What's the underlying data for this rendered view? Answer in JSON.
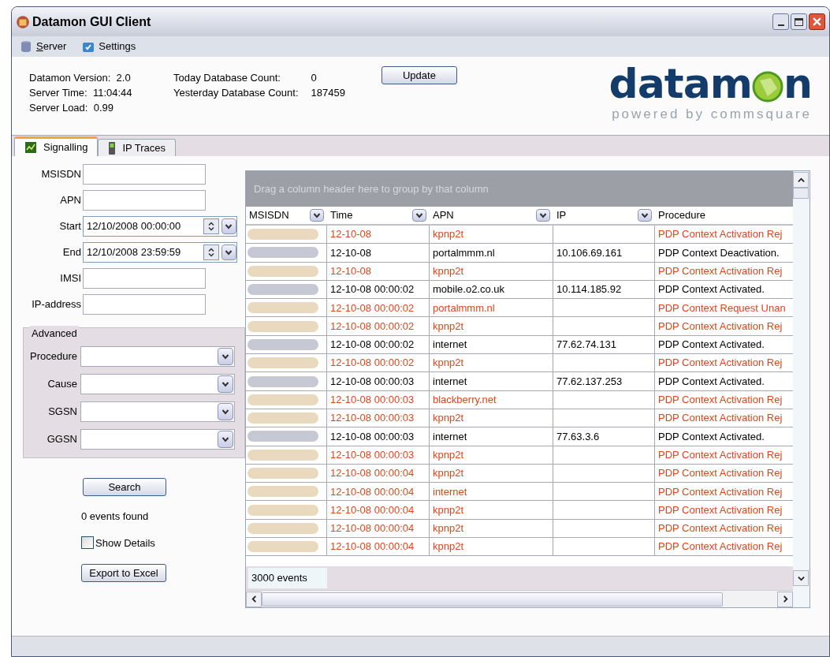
{
  "window": {
    "title": "Datamon GUI Client"
  },
  "menu": [
    {
      "label": "Server"
    },
    {
      "label": "Settings"
    }
  ],
  "info": [
    {
      "label": "Datamon Version:",
      "value": "2.0"
    },
    {
      "label": "Server Time:",
      "value": "11:04:44"
    },
    {
      "label": "Server Load:",
      "value": "0.99"
    }
  ],
  "counts": [
    {
      "label": "Today Database Count:",
      "value": "0"
    },
    {
      "label": "Yesterday Database Count:",
      "value": "187459"
    }
  ],
  "update_button": "Update",
  "logo": {
    "before": "datam",
    "after": "n",
    "tagline": "powered by commsquare"
  },
  "tabs": [
    {
      "label": "Signalling",
      "selected": true
    },
    {
      "label": "IP Traces",
      "selected": false
    }
  ],
  "fields": [
    {
      "label": "MSISDN",
      "kind": "text"
    },
    {
      "label": "APN",
      "kind": "text"
    },
    {
      "label": "Start",
      "kind": "datetime",
      "value": "12/10/2008 00:00:00"
    },
    {
      "label": "End",
      "kind": "datetime",
      "value": "12/10/2008 23:59:59"
    },
    {
      "label": "IMSI",
      "kind": "text"
    },
    {
      "label": "IP-address",
      "kind": "text"
    }
  ],
  "advanced": {
    "title": "Advanced",
    "fields": [
      "Procedure",
      "Cause",
      "SGSN",
      "GGSN"
    ]
  },
  "search_button": "Search",
  "events_found": "0 events found",
  "show_details": {
    "label": "Show Details",
    "checked": false
  },
  "export_button": "Export to Excel",
  "table": {
    "group_hint": "Drag a column header here to group by that column",
    "columns": [
      "MSISDN",
      "Time",
      "APN",
      "IP",
      "Procedure"
    ],
    "rows": [
      {
        "kind": "error",
        "time": "12-10-08",
        "apn": "kpnp2t",
        "ip": "",
        "procedure": "PDP Context Activation Rej"
      },
      {
        "kind": "normal",
        "time": "12-10-08",
        "apn": "portalmmm.nl",
        "ip": "10.106.69.161",
        "procedure": "PDP Context Deactivation."
      },
      {
        "kind": "error",
        "time": "12-10-08",
        "apn": "kpnp2t",
        "ip": "",
        "procedure": "PDP Context Activation Rej"
      },
      {
        "kind": "normal",
        "time": "12-10-08 00:00:02",
        "apn": "mobile.o2.co.uk",
        "ip": "10.114.185.92",
        "procedure": "PDP Context Activated."
      },
      {
        "kind": "error",
        "time": "12-10-08 00:00:02",
        "apn": "portalmmm.nl",
        "ip": "",
        "procedure": "PDP Context Request Unan"
      },
      {
        "kind": "error",
        "time": "12-10-08 00:00:02",
        "apn": "kpnp2t",
        "ip": "",
        "procedure": "PDP Context Activation Rej"
      },
      {
        "kind": "normal",
        "time": "12-10-08 00:00:02",
        "apn": "internet",
        "ip": "77.62.74.131",
        "procedure": "PDP Context Activated."
      },
      {
        "kind": "error",
        "time": "12-10-08 00:00:02",
        "apn": "kpnp2t",
        "ip": "",
        "procedure": "PDP Context Activation Rej"
      },
      {
        "kind": "normal",
        "time": "12-10-08 00:00:03",
        "apn": "internet",
        "ip": "77.62.137.253",
        "procedure": "PDP Context Activated."
      },
      {
        "kind": "error",
        "time": "12-10-08 00:00:03",
        "apn": "blackberry.net",
        "ip": "",
        "procedure": "PDP Context Activation Rej"
      },
      {
        "kind": "error",
        "time": "12-10-08 00:00:03",
        "apn": "kpnp2t",
        "ip": "",
        "procedure": "PDP Context Activation Rej"
      },
      {
        "kind": "normal",
        "time": "12-10-08 00:00:03",
        "apn": "internet",
        "ip": "77.63.3.6",
        "procedure": "PDP Context Activated."
      },
      {
        "kind": "error",
        "time": "12-10-08 00:00:03",
        "apn": "kpnp2t",
        "ip": "",
        "procedure": "PDP Context Activation Rej"
      },
      {
        "kind": "error",
        "time": "12-10-08 00:00:04",
        "apn": "kpnp2t",
        "ip": "",
        "procedure": "PDP Context Activation Rej"
      },
      {
        "kind": "error",
        "time": "12-10-08 00:00:04",
        "apn": "internet",
        "ip": "",
        "procedure": "PDP Context Activation Rej"
      },
      {
        "kind": "error",
        "time": "12-10-08 00:00:04",
        "apn": "kpnp2t",
        "ip": "",
        "procedure": "PDP Context Activation Rej"
      },
      {
        "kind": "error",
        "time": "12-10-08 00:00:04",
        "apn": "kpnp2t",
        "ip": "",
        "procedure": "PDP Context Activation Rej"
      },
      {
        "kind": "error",
        "time": "12-10-08 00:00:04",
        "apn": "kpnp2t",
        "ip": "",
        "procedure": "PDP Context Activation Rej"
      }
    ],
    "footer": "3000 events"
  }
}
